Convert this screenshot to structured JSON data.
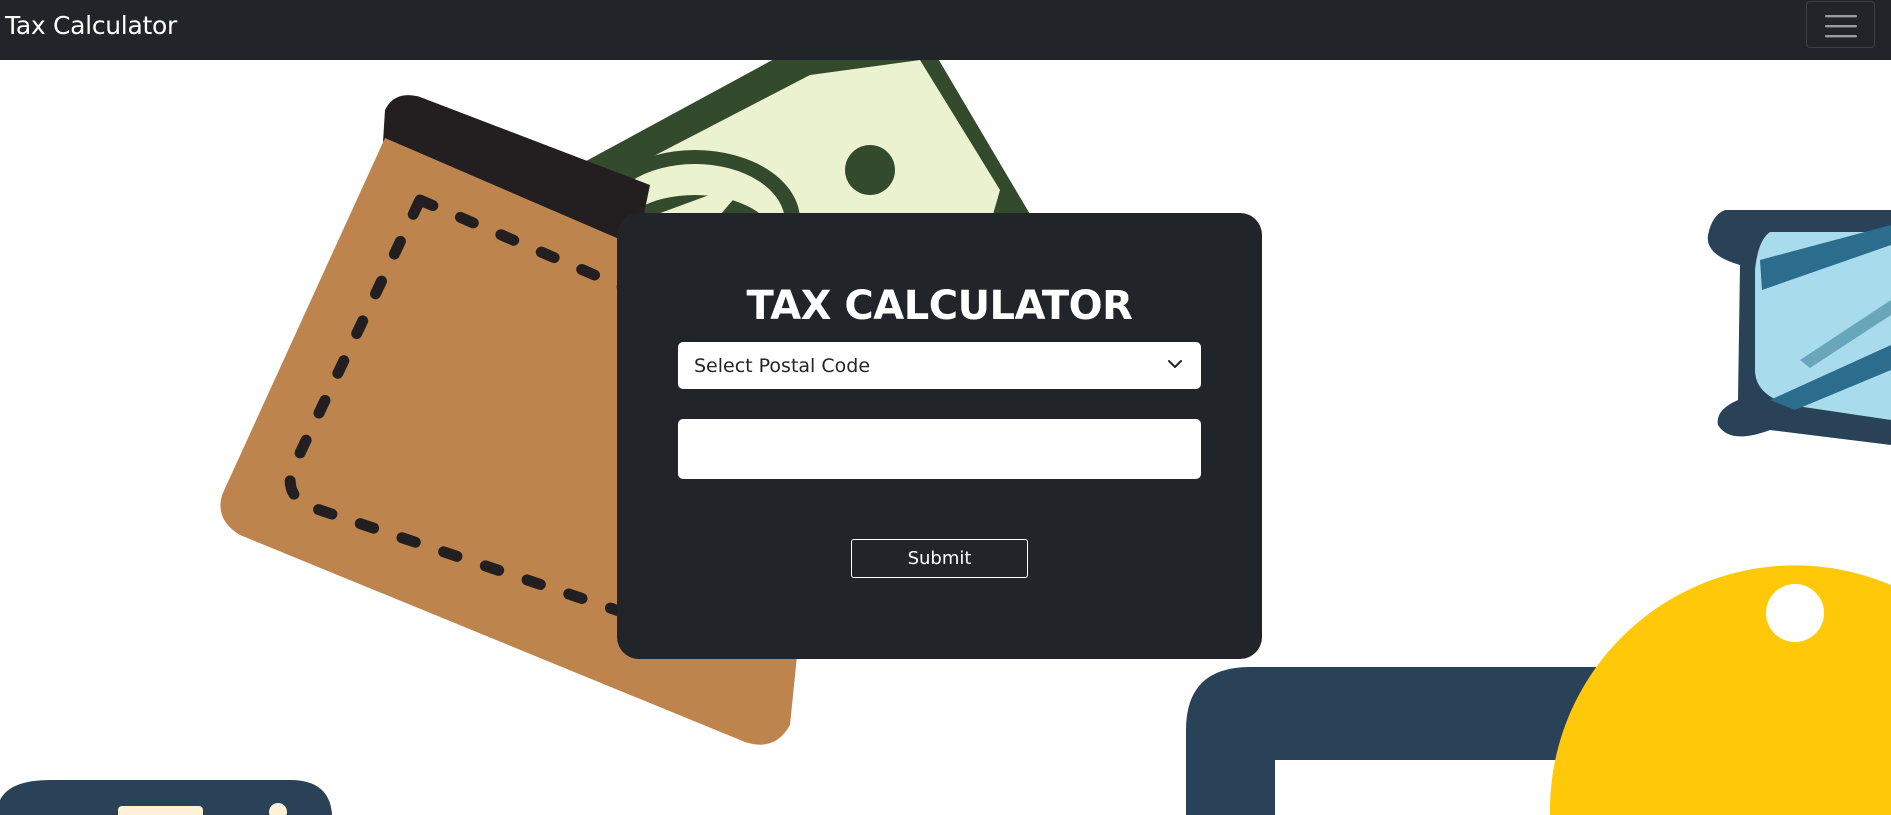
{
  "navbar": {
    "brand": "Tax Calculator",
    "menu_icon": "hamburger-menu-icon"
  },
  "form": {
    "title": "TAX CALCULATOR",
    "postal_select": {
      "selected": "Select Postal Code",
      "icon": "chevron-down-icon"
    },
    "amount_input": {
      "value": "",
      "placeholder": ""
    },
    "submit_label": "Submit"
  },
  "background": {
    "illustrations": [
      "wallet-illustration",
      "banknote-illustration",
      "glasses-illustration",
      "calculator-illustration",
      "coin-illustration",
      "card-illustration"
    ]
  },
  "colors": {
    "navbar_bg": "#212529",
    "card_bg": "#212529",
    "wallet": "#BD844D",
    "bill_dark": "#344A2D",
    "bill_light": "#EAF2D0",
    "navy": "#2A4257",
    "yellow": "#FFC90A"
  }
}
